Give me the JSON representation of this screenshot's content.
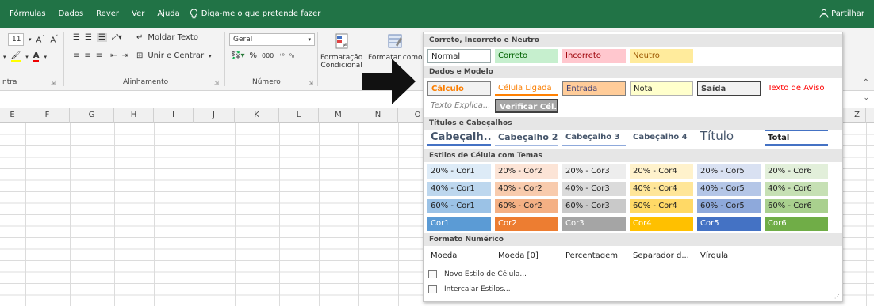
{
  "ribbon_tabs": [
    "Fórmulas",
    "Dados",
    "Rever",
    "Ver",
    "Ajuda"
  ],
  "tell_me": "Diga-me o que pretende fazer",
  "share_label": "Partilhar",
  "ribbon": {
    "font_size": "11",
    "wrap_text": "Moldar Texto",
    "merge_center": "Unir e Centrar",
    "number_format": "Geral",
    "percent_symbol": "%",
    "thousands": "000",
    "cond_format": "Formatação",
    "cond_format_2": "Condicional",
    "format_table": "Formatar como",
    "group_font_partial": "ntra",
    "group_alignment": "Alinhamento",
    "group_number": "Número"
  },
  "columns": [
    "E",
    "F",
    "G",
    "H",
    "I",
    "J",
    "K",
    "L",
    "M",
    "N",
    "O"
  ],
  "column_z": "Z",
  "gallery": {
    "sections": {
      "good_bad": "Correto, Incorreto e Neutro",
      "data_model": "Dados e Modelo",
      "titles": "Títulos e Cabeçalhos",
      "themed": "Estilos de Célula com Temas",
      "number": "Formato Numérico"
    },
    "good_bad": [
      "Normal",
      "Correto",
      "Incorreto",
      "Neutro"
    ],
    "data_model_1": [
      "Cálculo",
      "Célula Ligada",
      "Entrada",
      "Nota",
      "Saída",
      "Texto de Aviso"
    ],
    "data_model_2": [
      "Texto Explica...",
      "Verificar Cél..."
    ],
    "titles": [
      "Cabeçalh...",
      "Cabeçalho 2",
      "Cabeçalho 3",
      "Cabeçalho 4",
      "Título",
      "Total"
    ],
    "row20": [
      "20% - Cor1",
      "20% - Cor2",
      "20% - Cor3",
      "20% - Cor4",
      "20% - Cor5",
      "20% - Cor6"
    ],
    "row40": [
      "40% - Cor1",
      "40% - Cor2",
      "40% - Cor3",
      "40% - Cor4",
      "40% - Cor5",
      "40% - Cor6"
    ],
    "row60": [
      "60% - Cor1",
      "60% - Cor2",
      "60% - Cor3",
      "60% - Cor4",
      "60% - Cor5",
      "60% - Cor6"
    ],
    "row_accent": [
      "Cor1",
      "Cor2",
      "Cor3",
      "Cor4",
      "Cor5",
      "Cor6"
    ],
    "number": [
      "Moeda",
      "Moeda [0]",
      "Percentagem",
      "Separador d...",
      "Vírgula"
    ],
    "new_style": "Novo Estilo de Célula...",
    "merge_styles": "Intercalar Estilos..."
  },
  "colors": {
    "ribbon_green": "#217346",
    "accent1": "#5b9bd5",
    "accent2": "#ed7d31",
    "accent3": "#a5a5a5",
    "accent4": "#ffc000",
    "accent5": "#4472c4",
    "accent6": "#70ad47"
  }
}
